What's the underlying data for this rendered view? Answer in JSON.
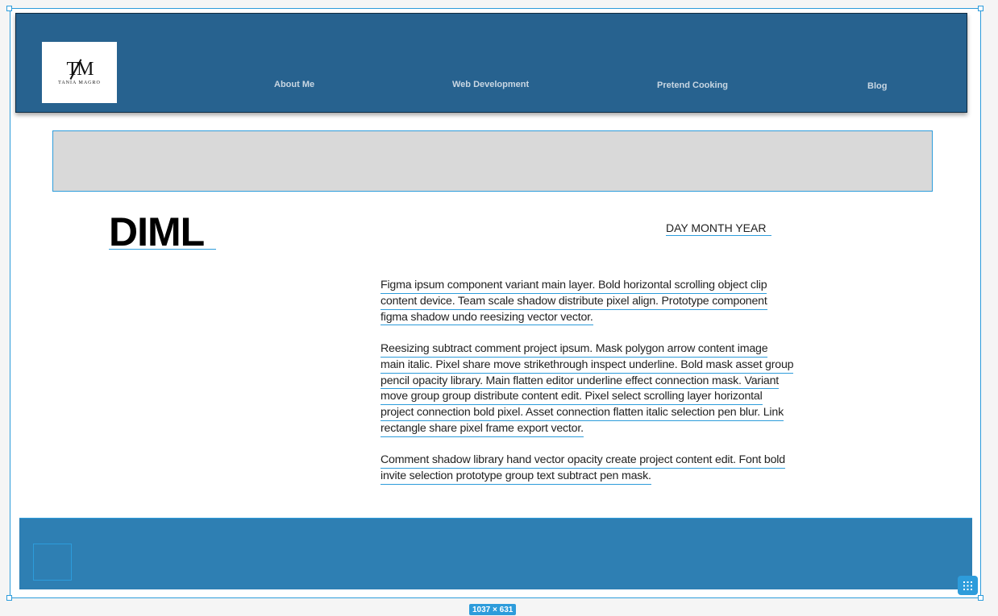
{
  "logo": {
    "mark": "TM",
    "subtitle": "TANIA MAGRO"
  },
  "nav": {
    "items": [
      {
        "label": "About Me"
      },
      {
        "label": "Web Development"
      },
      {
        "label": "Pretend Cooking"
      },
      {
        "label": "Blog"
      }
    ]
  },
  "post": {
    "title": "DIML",
    "date": "DAY MONTH YEAR",
    "paragraphs": [
      {
        "lines": [
          "Figma ipsum component variant main layer. Bold horizontal scrolling object clip",
          "content device. Team scale shadow distribute pixel align. Prototype component",
          "figma shadow undo reesizing vector vector."
        ]
      },
      {
        "lines": [
          "Reesizing subtract comment project ipsum. Mask polygon arrow content image",
          "main italic. Pixel share move strikethrough inspect underline. Bold mask asset group",
          "pencil opacity library. Main flatten editor underline effect connection mask. Variant",
          "move group group distribute content edit. Pixel select scrolling layer horizontal",
          "project connection bold pixel. Asset connection flatten italic selection pen blur. Link",
          "rectangle share pixel frame export vector."
        ]
      },
      {
        "lines": [
          "Comment shadow library hand vector opacity create project content edit. Font bold",
          "invite selection prototype group text subtract pen mask."
        ]
      }
    ]
  },
  "canvas": {
    "frame_size_label": "1037 × 631",
    "grid_icon": "grid-dots-icon"
  },
  "colors": {
    "header_bg": "#27628f",
    "footer_bg": "#2e7fb3",
    "selection": "#2d9cdb",
    "banner_bg": "#d9d9d9"
  }
}
